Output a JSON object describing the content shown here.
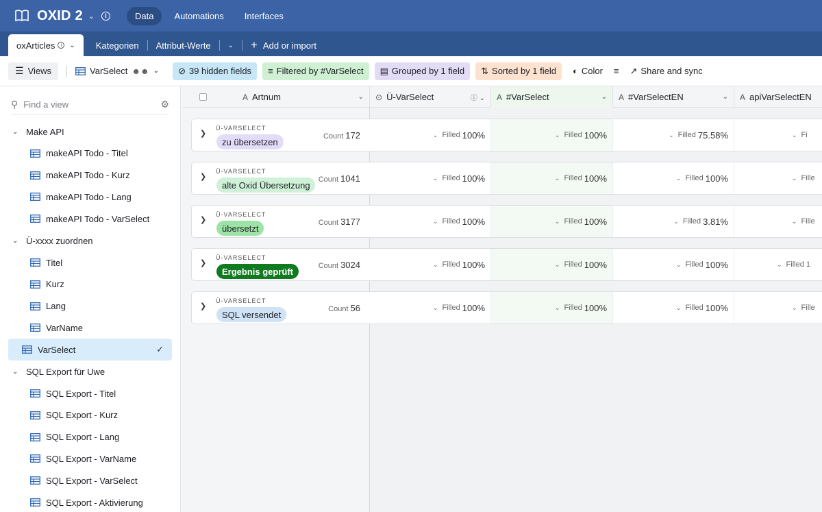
{
  "app": {
    "base_name": "OXID 2",
    "nav": [
      "Data",
      "Automations",
      "Interfaces"
    ],
    "active_nav": "Data"
  },
  "tabs": {
    "active": "oxArticles",
    "others": [
      "Kategorien",
      "Attribut-Werte"
    ],
    "add_label": "Add or import"
  },
  "toolbar": {
    "views_label": "Views",
    "current_view": "VarSelect",
    "hidden_fields": "39 hidden fields",
    "filtered": "Filtered by #VarSelect",
    "grouped": "Grouped by 1 field",
    "sorted": "Sorted by 1 field",
    "color": "Color",
    "share": "Share and sync"
  },
  "sidebar": {
    "find_placeholder": "Find a view",
    "sections": [
      {
        "label": "Make API",
        "items": [
          "makeAPI Todo - Titel",
          "makeAPI Todo - Kurz",
          "makeAPI Todo - Lang",
          "makeAPI Todo - VarSelect"
        ]
      },
      {
        "label": "Ü-xxxx zuordnen",
        "items": [
          "Titel",
          "Kurz",
          "Lang",
          "VarName",
          "VarSelect"
        ]
      },
      {
        "label": "SQL Export für Uwe",
        "items": [
          "SQL Export - Titel",
          "SQL Export - Kurz",
          "SQL Export - Lang",
          "SQL Export - VarName",
          "SQL Export - VarSelect",
          "SQL Export - Aktivierung"
        ]
      }
    ],
    "selected_item": "VarSelect"
  },
  "grid": {
    "columns": [
      "Artnum",
      "Ü-VarSelect",
      "#VarSelect",
      "#VarSelectEN",
      "apiVarSelectEN"
    ],
    "group_field_label": "Ü-VARSELECT",
    "count_label": "Count",
    "filled_label": "Filled",
    "groups": [
      {
        "value": "zu übersetzen",
        "count": "172",
        "c1": "100%",
        "c2": "100%",
        "c3": "75.58%"
      },
      {
        "value": "alte Oxid Übersetzung",
        "count": "1041",
        "c1": "100%",
        "c2": "100%",
        "c3": "100%"
      },
      {
        "value": "übersetzt",
        "count": "3177",
        "c1": "100%",
        "c2": "100%",
        "c3": "3.81%"
      },
      {
        "value": "Ergebnis geprüft",
        "count": "3024",
        "c1": "100%",
        "c2": "100%",
        "c3": "100%"
      },
      {
        "value": "SQL versendet",
        "count": "56",
        "c1": "100%",
        "c2": "100%",
        "c3": "100%"
      }
    ],
    "last_col_cut": [
      "Fi",
      "Fille",
      "Fille",
      "Filled 1",
      "Fille"
    ]
  },
  "colors": {
    "topbar": "#3b63a6",
    "tabrow": "#2f568f",
    "pill_lavender": "#e3dcf9",
    "pill_mint": "#cff1d7",
    "pill_green": "#9ee3a6",
    "pill_dark_green": "#0f7a1f",
    "pill_blue": "#cfe2f6"
  }
}
